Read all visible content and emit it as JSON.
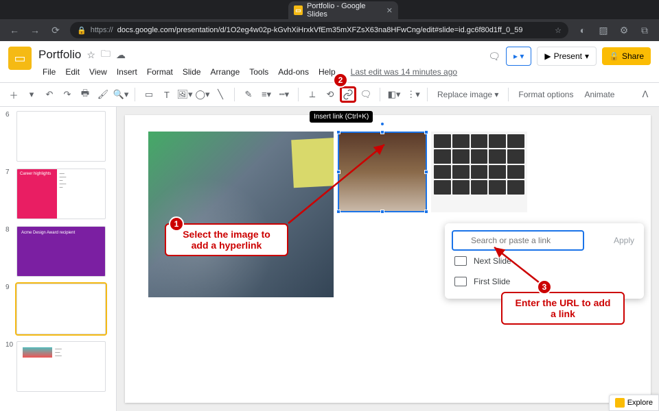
{
  "browser": {
    "tab_title": "Portfolio - Google Slides",
    "url_prefix": "https://",
    "url": "docs.google.com/presentation/d/1O2eg4w02p-kGvhXiHrxkVfEm35mXFZsX63na8HFwCng/edit#slide=id.gc6f80d1ff_0_59"
  },
  "doc": {
    "title": "Portfolio",
    "menu": [
      "File",
      "Edit",
      "View",
      "Insert",
      "Format",
      "Slide",
      "Arrange",
      "Tools",
      "Add-ons",
      "Help"
    ],
    "last_edit": "Last edit was 14 minutes ago",
    "present_label": "Present",
    "share_label": "Share"
  },
  "toolbar": {
    "replace_image": "Replace image",
    "format_options": "Format options",
    "animate": "Animate",
    "tooltip": "Insert link (Ctrl+K)"
  },
  "thumbs": {
    "n6": "6",
    "n7": "7",
    "n8": "8",
    "n9": "9",
    "n10": "10",
    "t7a": "Career highlights",
    "t8a": "Acme Design Award recipient"
  },
  "popover": {
    "placeholder": "Search or paste a link",
    "apply": "Apply",
    "item1": "Next Slide",
    "item2": "First Slide"
  },
  "callouts": {
    "n1": "1",
    "n2": "2",
    "n3": "3",
    "c1a": "Select the image to",
    "c1b": "add a hyperlink",
    "c3a": "Enter the URL to add",
    "c3b": "a link"
  },
  "explore": {
    "label": "Explore"
  }
}
